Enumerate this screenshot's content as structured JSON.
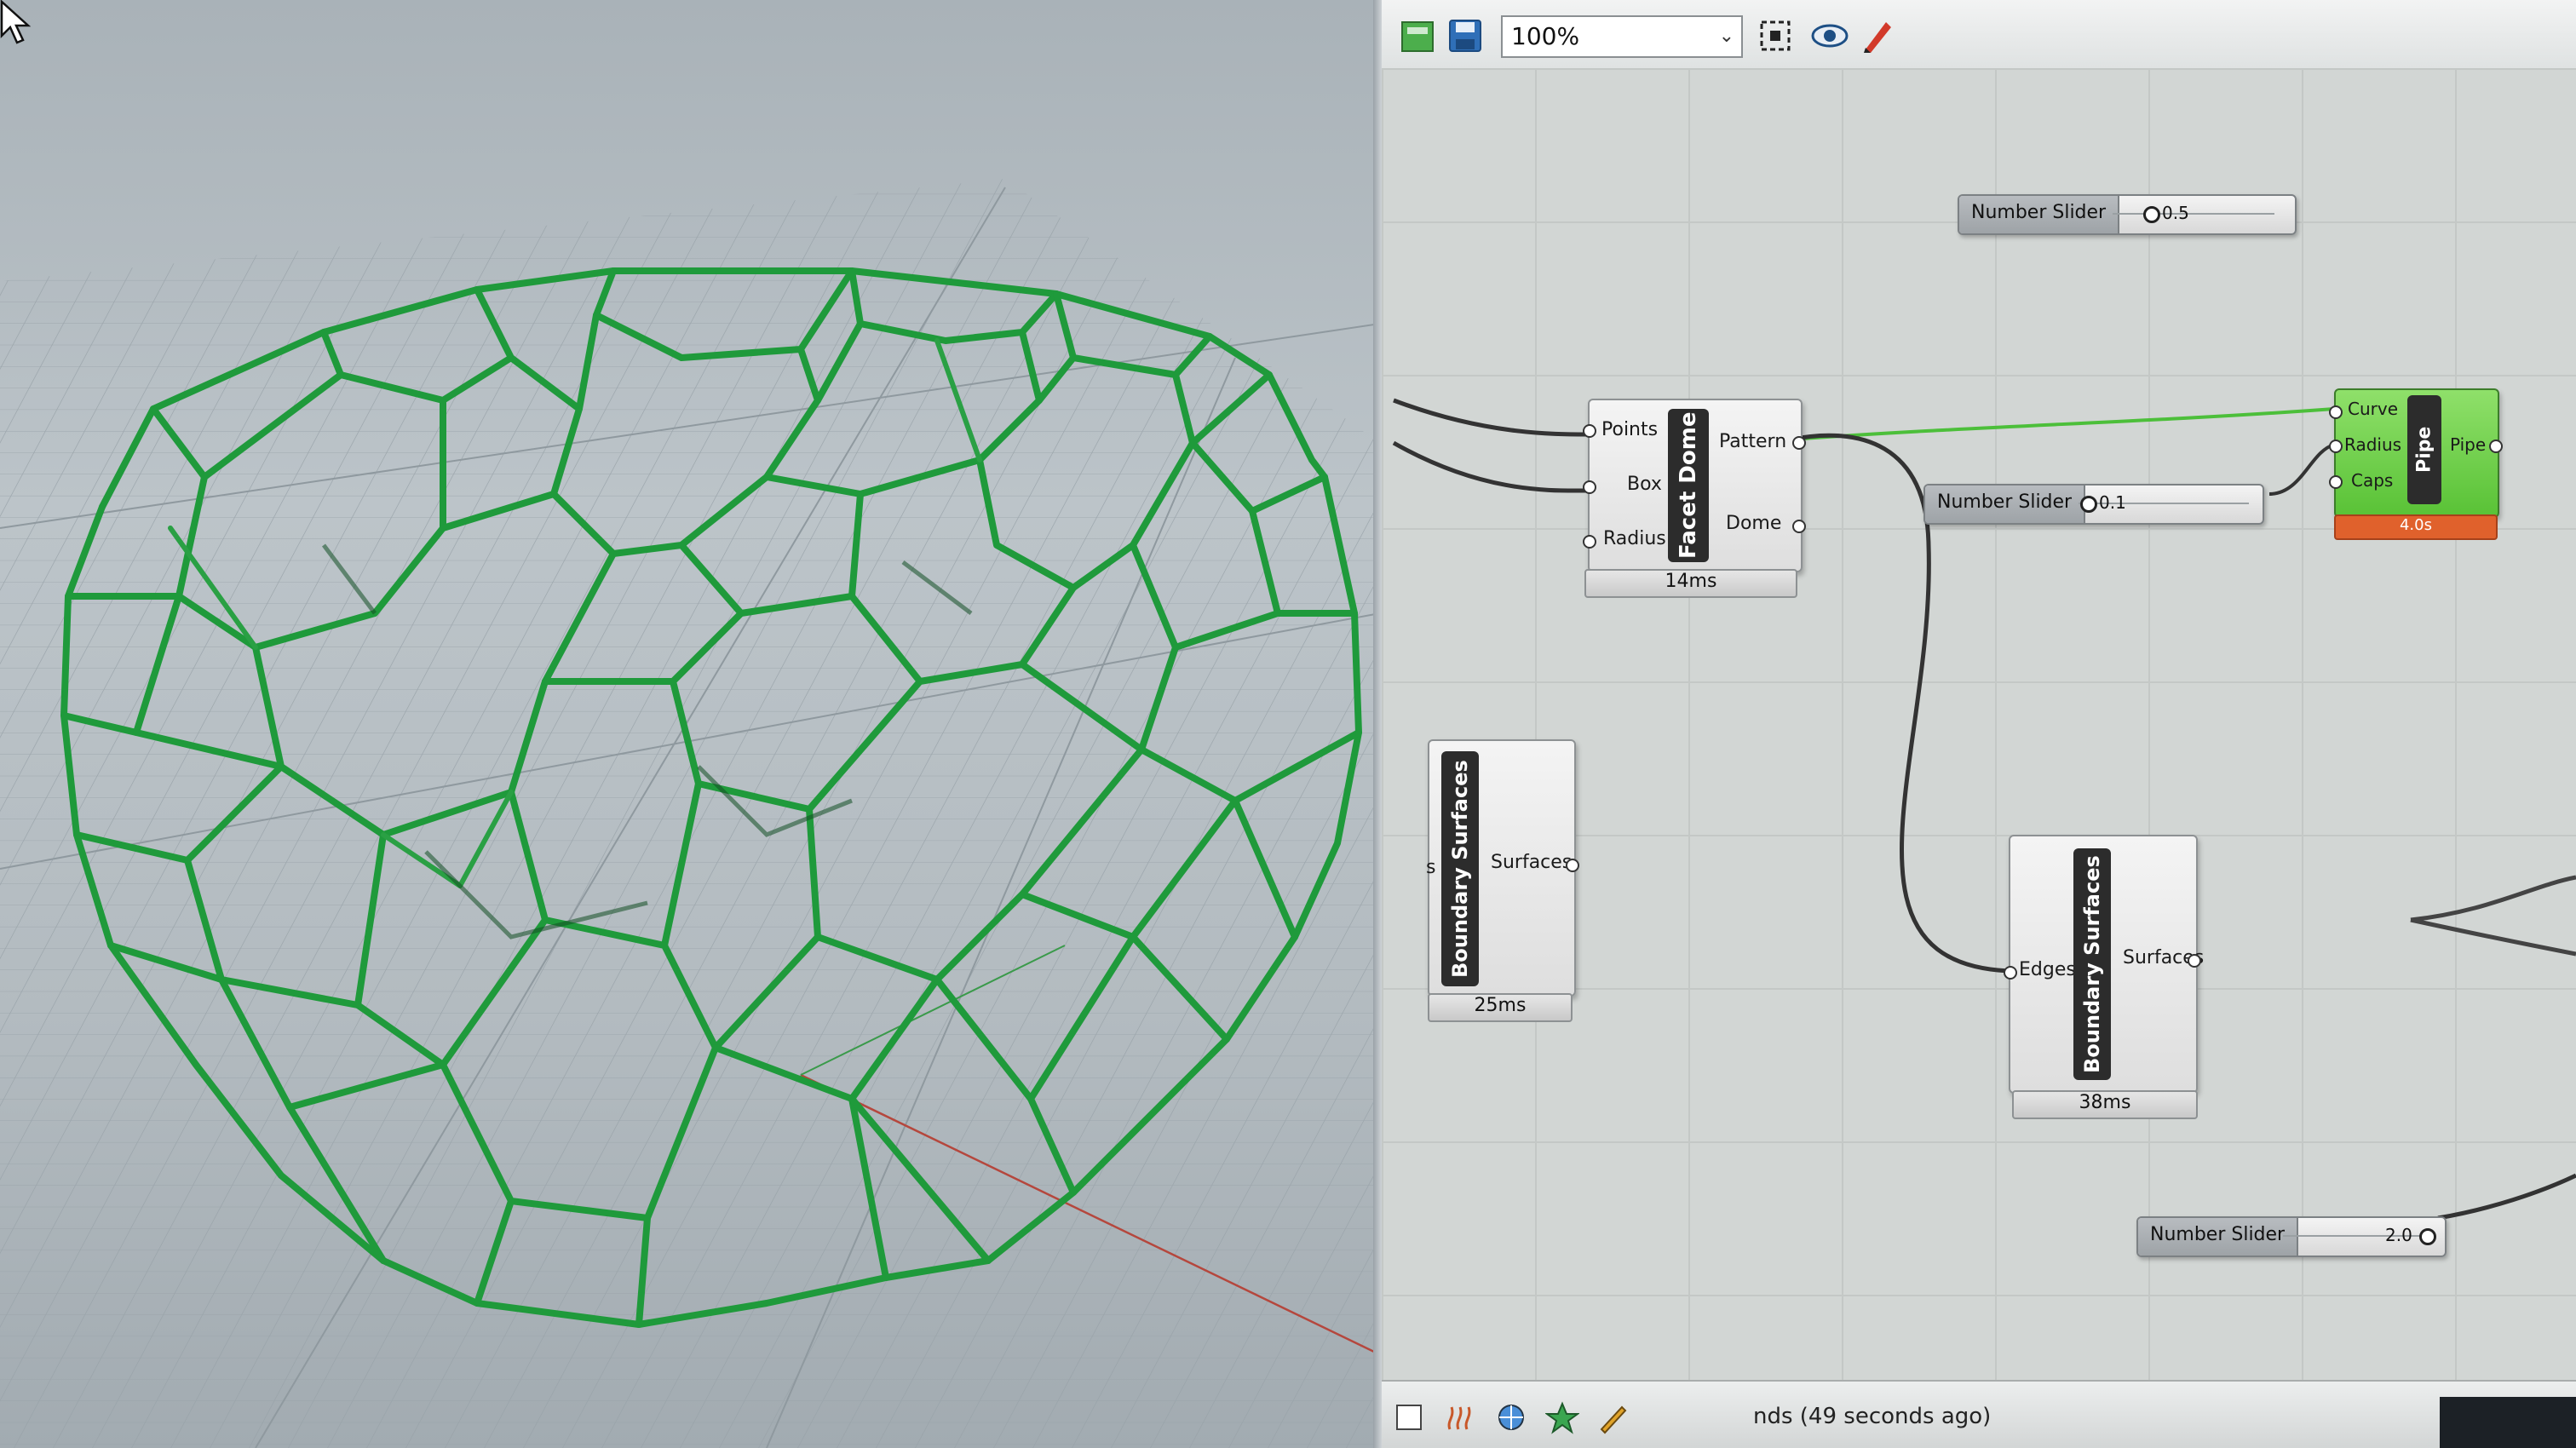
{
  "toolbar": {
    "zoom_value": "100%",
    "icons": [
      "new-document-icon",
      "save-icon",
      "zoom-extents-icon",
      "preview-eye-icon",
      "sketch-pen-icon"
    ]
  },
  "components": {
    "facet_dome": {
      "nickname": "Facet Dome",
      "inputs": [
        "Points",
        "Box",
        "Radius"
      ],
      "outputs": [
        "Pattern",
        "Dome"
      ],
      "timing": "14ms"
    },
    "boundary_surfaces_left": {
      "nickname": "Boundary Surfaces",
      "input_fragment": "s",
      "outputs": [
        "Surfaces"
      ],
      "timing": "25ms"
    },
    "boundary_surfaces_right": {
      "nickname": "Boundary Surfaces",
      "inputs": [
        "Edges"
      ],
      "outputs": [
        "Surfaces"
      ],
      "timing": "38ms"
    },
    "pipe": {
      "nickname": "Pipe",
      "inputs": [
        "Curve",
        "Radius",
        "Caps"
      ],
      "outputs": [
        "Pipe"
      ],
      "timing": "4.0s"
    }
  },
  "sliders": [
    {
      "label": "Number Slider",
      "value": "0.5"
    },
    {
      "label": "Number Slider",
      "value": "0.1"
    },
    {
      "label": "Number Slider",
      "value": "2.0"
    }
  ],
  "status": {
    "text": "nds (49 seconds ago)"
  },
  "colors": {
    "pipe_green": "#4cbf3a",
    "timing_warning": "#e0612c",
    "geometry_green": "#1f9a3b",
    "x_axis_red": "#b5473d"
  }
}
